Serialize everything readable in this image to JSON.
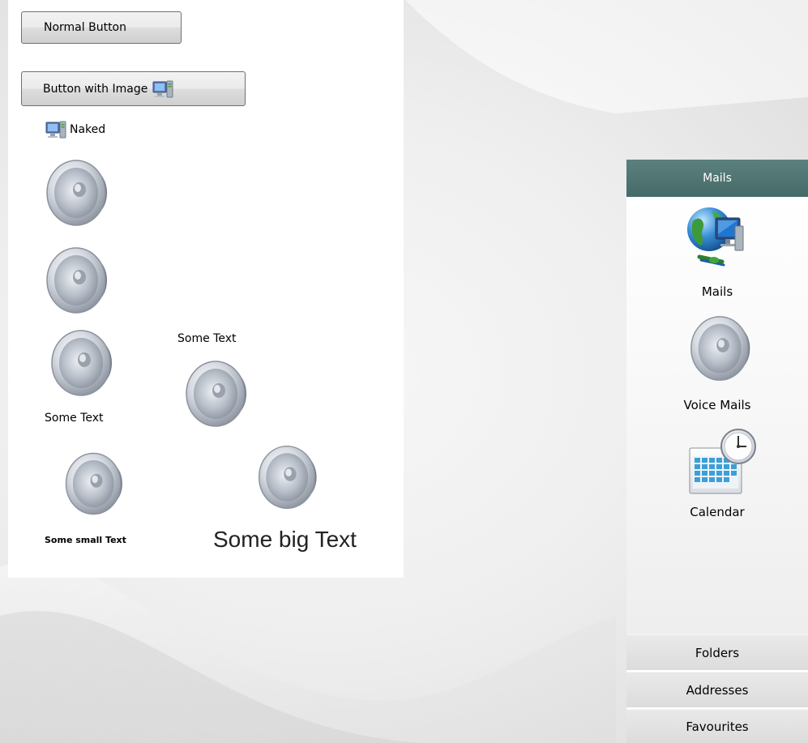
{
  "buttons": {
    "normal_label": "Normal Button",
    "image_button_label": "Button with Image",
    "naked_label": "Naked"
  },
  "labels": {
    "some_text_below": "Some Text",
    "some_text_above": "Some Text",
    "small_text": "Some small Text",
    "big_text": "Some big Text"
  },
  "nav": {
    "header": "Mails",
    "items": [
      {
        "label": "Mails",
        "icon": "network-globe-icon"
      },
      {
        "label": "Voice Mails",
        "icon": "speaker-icon"
      },
      {
        "label": "Calendar",
        "icon": "calendar-icon"
      }
    ],
    "sections": [
      "Folders",
      "Addresses",
      "Favourites"
    ]
  },
  "colors": {
    "nav_header": "#4f7573",
    "button_border": "#707070"
  }
}
